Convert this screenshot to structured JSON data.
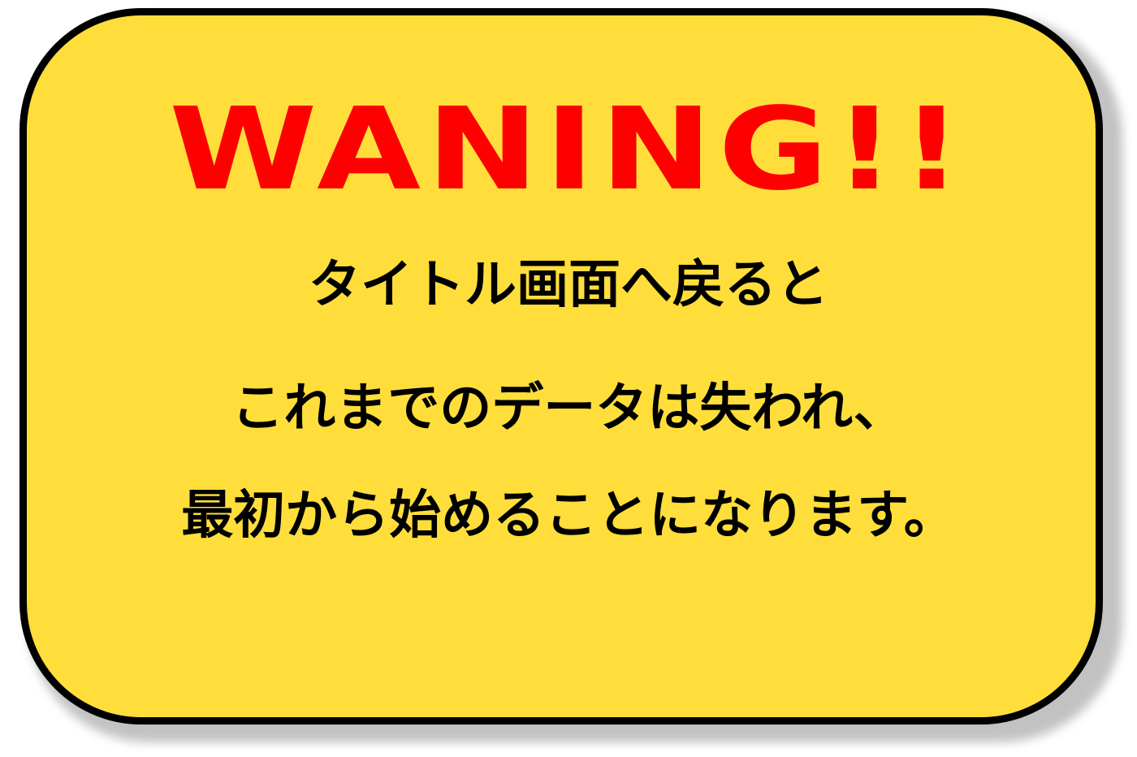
{
  "dialog": {
    "title": "WANING!!",
    "title_color": "#ff0000",
    "background_color": "#ffde3b",
    "border_color": "#000000",
    "lines": [
      "タイトル画面へ戻ると",
      "これまでのデータは失われ、",
      "最初から始めることになります。"
    ]
  }
}
